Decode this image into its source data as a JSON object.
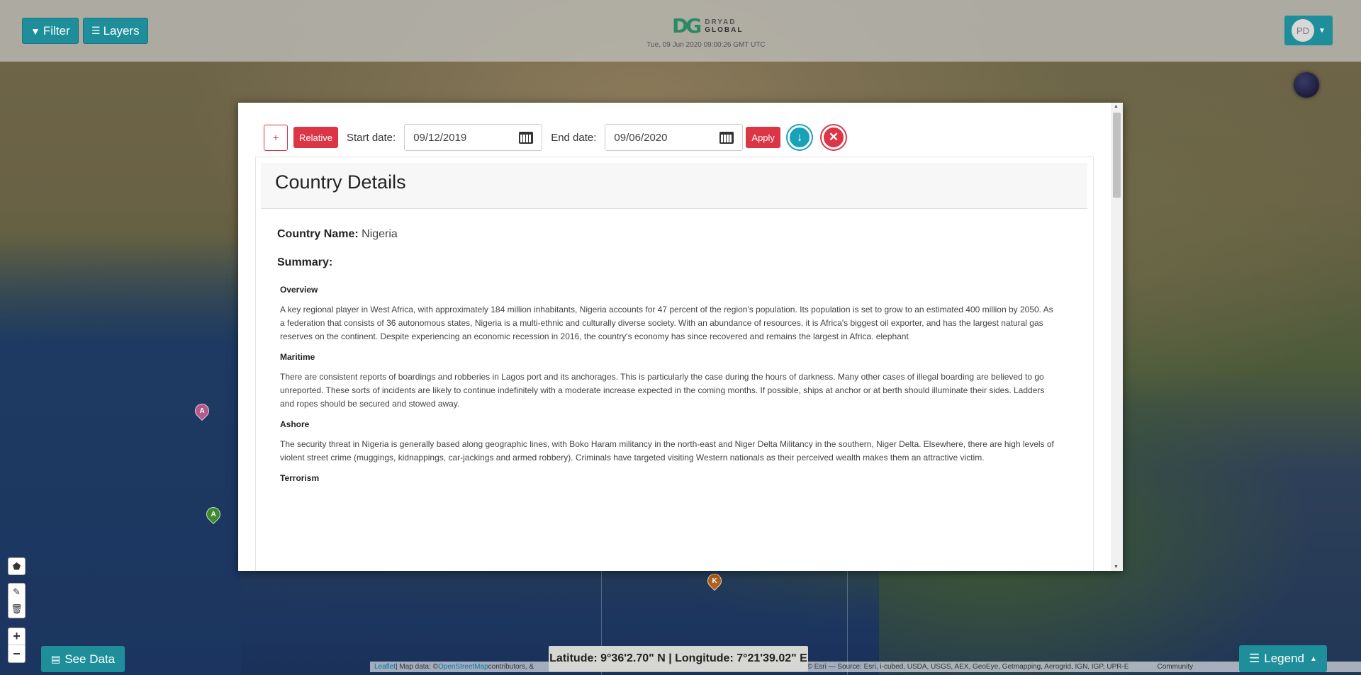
{
  "topbar": {
    "filter_label": "Filter",
    "layers_label": "Layers",
    "logo_mark": "DG",
    "logo_line1": "DRYAD",
    "logo_line2": "GLOBAL",
    "datetime": "Tue, 09 Jun 2020 09:00:26 GMT UTC",
    "user_initials": "PD"
  },
  "map": {
    "markers": [
      "A",
      "A",
      "K"
    ],
    "see_data_label": "See Data",
    "legend_label": "Legend",
    "coords_text": "Latitude: 9°36'2.70\" N | Longitude: 7°21'39.02\" E",
    "attribution_leaflet": "Leaflet",
    "attribution_text1": " | Map data: © ",
    "attribution_osm": "OpenStreetMap",
    "attribution_text2": " contributors, & ",
    "attribution_text3": "a> contributors, Tiles © Esri — Source: Esri, i-cubed, USDA, USGS, AEX, GeoEye, Getmapping, Aerogrid, IGN, IGP, UPR-E",
    "attribution_text4": "Community"
  },
  "modal": {
    "plus_label": "+",
    "relative_label": "Relative",
    "start_label": "Start date:",
    "start_value": "09/12/2019",
    "end_label": "End date:",
    "end_value": "09/06/2020",
    "apply_label": "Apply",
    "card_title": "Country Details",
    "country_name_label": "Country Name:",
    "country_name_value": "Nigeria",
    "summary_label": "Summary:",
    "sections": [
      {
        "heading": "Overview",
        "body": "A key regional player in West Africa, with approximately 184 million inhabitants, Nigeria accounts for 47 percent of the region's population. Its population is set to grow to an estimated 400 million by 2050. As a federation that consists of 36 autonomous states, Nigeria is a multi-ethnic and culturally diverse society. With an abundance of resources, it is Africa's biggest oil exporter, and has the largest natural gas reserves on the continent. Despite experiencing an economic recession in 2016, the country's economy has since recovered and remains the largest in Africa. elephant"
      },
      {
        "heading": "Maritime",
        "body": "There are consistent reports of boardings and robberies in Lagos port and its anchorages. This is particularly the case during the hours of darkness. Many other cases of illegal boarding are believed to go unreported. These sorts of incidents are likely to continue indefinitely with a moderate increase expected in the coming months. If possible, ships at anchor or at berth should illuminate their sides. Ladders and ropes should be secured and stowed away."
      },
      {
        "heading": "Ashore",
        "body": "The security threat in Nigeria is generally based along geographic lines, with Boko Haram militancy in the north-east and Niger Delta Militancy in the southern, Niger Delta. Elsewhere, there are high levels of violent street crime (muggings, kidnappings, car-jackings and armed robbery). Criminals have targeted visiting Western nationals as their perceived wealth makes them an attractive victim."
      },
      {
        "heading": "Terrorism",
        "body": ""
      }
    ]
  },
  "colors": {
    "teal": "#1e8f9a",
    "red": "#dc3545",
    "download_blue": "#17a2b8"
  }
}
